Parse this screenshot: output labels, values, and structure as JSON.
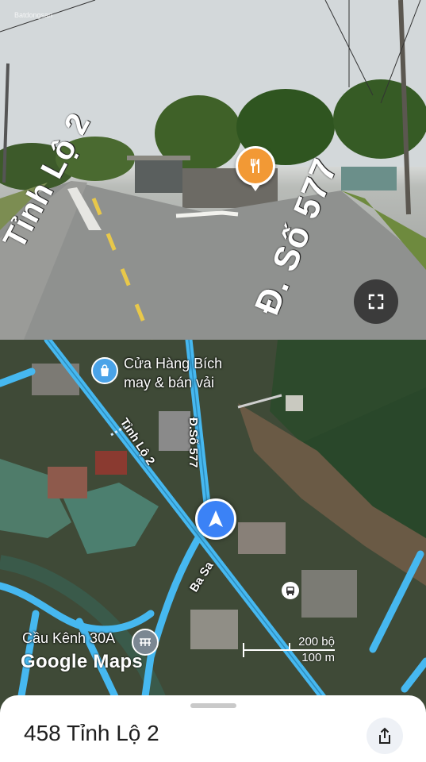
{
  "street_view": {
    "watermark": "Batdongsan",
    "road_left_label": "Tỉnh Lộ 2",
    "road_right_label": "Đ. Số 577",
    "poi_icon": "restaurant-icon",
    "expand_icon": "fullscreen-icon"
  },
  "map": {
    "shop_name_line1": "Cửa Hàng Bích",
    "shop_name_line2": "may & bán vải",
    "shop_icon": "shopping-bag-icon",
    "road_tinh_lo": "Tỉnh Lộ 2",
    "road_so_577": "Đ.Số 577",
    "road_ba_sa": "Ba Sa",
    "bus_icon": "bus-stop-icon",
    "bridge_name": "Cầu Kênh 30A",
    "bridge_icon": "bridge-icon",
    "logo": "Google Maps",
    "scale_top": "200 bộ",
    "scale_bottom": "100 m"
  },
  "sheet": {
    "title": "458 Tỉnh Lộ 2",
    "share_icon": "share-icon"
  },
  "colors": {
    "road_blue": "#46b8f0",
    "nav_blue": "#3b82f6",
    "poi_orange": "#f29935",
    "shop_blue": "#4aa3e8"
  }
}
